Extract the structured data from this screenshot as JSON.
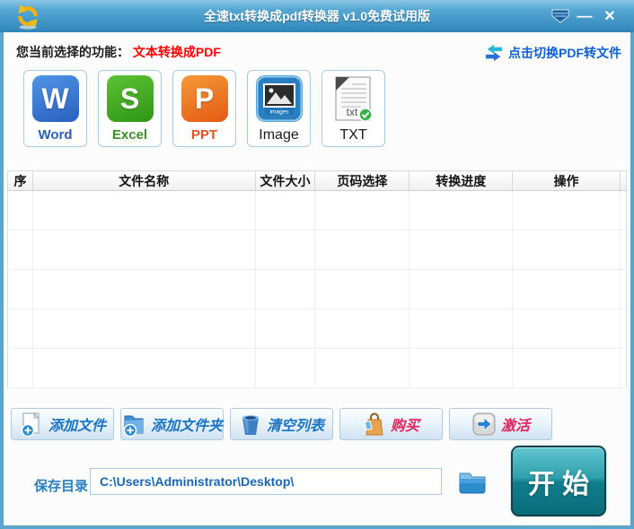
{
  "title_bar": {
    "title": "全速txt转换成pdf转换器 v1.0免费试用版",
    "minimize_label": "—",
    "close_label": "✕"
  },
  "function_bar": {
    "prefix": "您当前选择的功能：",
    "current": "文本转换成PDF",
    "switch_link": "点击切换PDF转文件"
  },
  "formats": [
    {
      "label": "Word",
      "glyph": "W"
    },
    {
      "label": "Excel",
      "glyph": "S"
    },
    {
      "label": "PPT",
      "glyph": "P"
    },
    {
      "label": "Image"
    },
    {
      "label": "TXT",
      "badge": "txt"
    }
  ],
  "table": {
    "headers": [
      "序",
      "文件名称",
      "文件大小",
      "页码选择",
      "转换进度",
      "操作"
    ],
    "rows": []
  },
  "toolbar": [
    {
      "label": "添加文件"
    },
    {
      "label": "添加文件夹"
    },
    {
      "label": "清空列表"
    },
    {
      "label": "购买"
    },
    {
      "label": "激活"
    }
  ],
  "footer": {
    "save_dir_label": "保存目录",
    "save_dir_value": "C:\\Users\\Administrator\\Desktop\\",
    "start_label": "开始"
  },
  "colors": {
    "titlebar_blue": "#2f86b8",
    "window_border": "#5aa5cb",
    "accent_red": "#ff0000",
    "link_blue": "#105fd0",
    "toolbar_blue": "#1a74c4",
    "toolbar_red": "#e0265c",
    "start_teal": "#0f7e8c"
  }
}
